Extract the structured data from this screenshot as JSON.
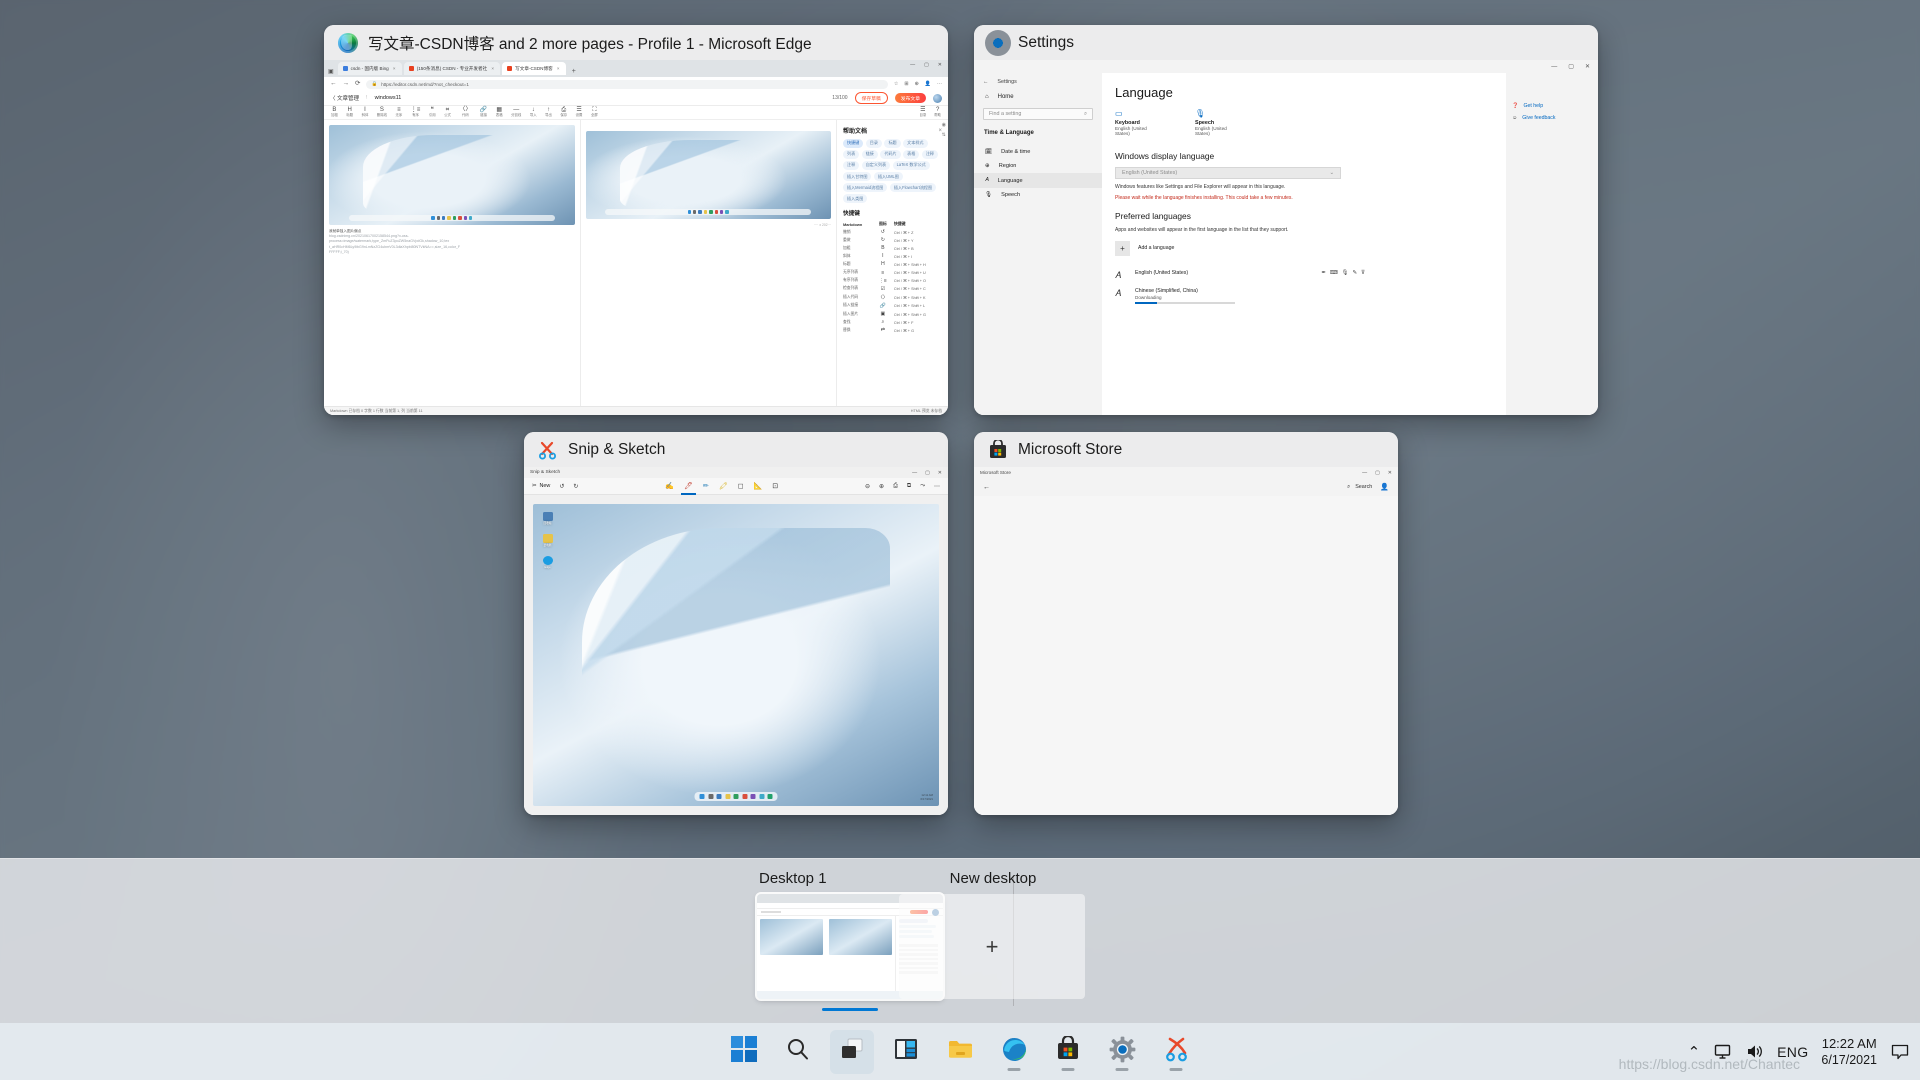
{
  "os": "Windows 11 Task View",
  "windows": {
    "edge": {
      "title": "写文章-CSDN博客 and 2 more pages - Profile 1 - Microsoft Edge",
      "icon": "edge-icon",
      "tabs": [
        {
          "label": "csdn - 国内版 Bing",
          "favicon": "#3b7ddd"
        },
        {
          "label": "(150条消息) CSDN - 专业开发者社",
          "favicon": "#e8401f"
        },
        {
          "label": "写文章-CSDN博客",
          "favicon": "#e8401f",
          "active": true
        }
      ],
      "new_tab_label": "+",
      "url": "https://editor.csdn.net/md/?not_checkout=1",
      "nav": {
        "back": "←",
        "forward": "→",
        "refresh": "⟳",
        "lock": "🔒"
      },
      "toolbar_right": [
        "☆",
        "⊞",
        "⊕",
        "👤",
        "⋯"
      ],
      "csdn": {
        "back_label": "〈 文章管理",
        "title_placeholder": "!",
        "title_value": "windows11",
        "char_count": "13/100",
        "save_draft": "保存草稿",
        "publish": "发布文章",
        "format_tools": [
          {
            "glyph": "B",
            "label": "加粗"
          },
          {
            "glyph": "H",
            "label": "标题"
          },
          {
            "glyph": "I",
            "label": "斜体"
          },
          {
            "glyph": "S",
            "label": "删除线"
          },
          {
            "glyph": "≡",
            "label": "无序"
          },
          {
            "glyph": "⋮≡",
            "label": "有序"
          },
          {
            "glyph": "❝",
            "label": "引用"
          },
          {
            "glyph": "⌗",
            "label": "公式"
          },
          {
            "glyph": "〈〉",
            "label": "代码"
          },
          {
            "glyph": "🔗",
            "label": "链接"
          },
          {
            "glyph": "▦",
            "label": "表格"
          },
          {
            "glyph": "—",
            "label": "分割线"
          },
          {
            "glyph": "↓",
            "label": "导入"
          },
          {
            "glyph": "↑",
            "label": "导出"
          },
          {
            "glyph": "⎙",
            "label": "保存"
          },
          {
            "glyph": "☰",
            "label": "设置"
          },
          {
            "glyph": "⛶",
            "label": "全屏"
          }
        ],
        "right_tools": [
          {
            "glyph": "☰",
            "label": "目录"
          },
          {
            "glyph": "?",
            "label": "帮助"
          }
        ],
        "editor_note_lines": [
          "我就单独入图片偏点",
          "blog.csdnimg.cn/20210617002158544.png?x-oss-",
          "process=image/watermark,type_ZmFuZ3poZW5naGVpdGk,shadow_10,tex",
          "t_aHR0cHM6Ly9ibG9nLmNzZG4ubmV0L3dlaXhpbl80NTVkNA==,size_16,color_F",
          "FFFFF,t_70)"
        ],
        "status_left": "Markdown  已存档  0 字数  1 行数  当前第 1, 列 当前第 11",
        "status_right": "HTML 预览  未存档"
      },
      "help_panel": {
        "title": "帮助文档",
        "close": "×",
        "tags": [
          "快捷键",
          "目录",
          "标题",
          "文本样式",
          "列表",
          "链接",
          "代码片",
          "表格",
          "注释",
          "注释",
          "自定义列表",
          "LaTeX 数学公式",
          "插入甘特图",
          "插入UML图",
          "插入Mermaid流程图",
          "插入Flowchart流程图",
          "插入类图"
        ],
        "shortcut_heading": "快捷键",
        "table_headers": [
          "Markdown",
          "图标",
          "快捷键"
        ],
        "rows": [
          [
            "撤销",
            "↺",
            "Ctrl / ⌘ + Z"
          ],
          [
            "重做",
            "↻",
            "Ctrl / ⌘ + Y"
          ],
          [
            "加粗",
            "B",
            "Ctrl / ⌘ + B"
          ],
          [
            "斜体",
            "I",
            "Ctrl / ⌘ + I"
          ],
          [
            "标题",
            "H",
            "Ctrl / ⌘ + Shift + H"
          ],
          [
            "无序列表",
            "≡",
            "Ctrl / ⌘ + Shift + U"
          ],
          [
            "有序列表",
            "⋮≡",
            "Ctrl / ⌘ + Shift + O"
          ],
          [
            "检查列表",
            "☑",
            "Ctrl / ⌘ + Shift + C"
          ],
          [
            "插入代码",
            "〈〉",
            "Ctrl / ⌘ + Shift + K"
          ],
          [
            "插入链接",
            "🔗",
            "Ctrl / ⌘ + Shift + L"
          ],
          [
            "插入图片",
            "▣",
            "Ctrl / ⌘ + Shift + G"
          ],
          [
            "查找",
            "⌕",
            "Ctrl / ⌘ + F"
          ],
          [
            "替换",
            "⇄",
            "Ctrl / ⌘ + G"
          ]
        ]
      },
      "window_controls": [
        "—",
        "▢",
        "✕"
      ]
    },
    "settings": {
      "title": "Settings",
      "icon": "gear-icon",
      "window_controls": [
        "—",
        "▢",
        "✕"
      ],
      "sidebar": {
        "back_label": "Settings",
        "home": "Home",
        "search_placeholder": "Find a setting",
        "search_icon": "search-icon",
        "group_header": "Time & Language",
        "items": [
          {
            "label": "Date & time",
            "icon": "calendar-clock-icon",
            "selected": false
          },
          {
            "label": "Region",
            "icon": "globe-icon",
            "selected": false
          },
          {
            "label": "Language",
            "icon": "language-icon",
            "selected": true
          },
          {
            "label": "Speech",
            "icon": "microphone-icon",
            "selected": false
          }
        ]
      },
      "content": {
        "heading": "Language",
        "quick_settings": [
          {
            "icon": "keyboard-icon",
            "title": "Keyboard",
            "subtitle": "English (United States)"
          },
          {
            "icon": "speech-icon",
            "title": "Speech",
            "subtitle": "English (United States)"
          }
        ],
        "display_language_heading": "Windows display language",
        "display_language_value": "English (United States)",
        "display_language_note": "Windows features like Settings and File Explorer will appear in this language.",
        "warning": "Please wait while the language finishes installing. This could take a few minutes.",
        "preferred_heading": "Preferred languages",
        "preferred_note": "Apps and websites will appear in the first language in the list that they support.",
        "add_language_label": "Add a language",
        "add_language_icon": "plus-icon",
        "languages": [
          {
            "name": "English (United States)",
            "status": "",
            "icon": "language-badge-icon",
            "actions": [
              "pen-icon",
              "keyboard-icon",
              "microphone-icon",
              "handwriting-icon",
              "text-icon"
            ],
            "progress": null
          },
          {
            "name": "Chinese (Simplified, China)",
            "status": "Downloading",
            "icon": "language-badge-icon",
            "actions": [],
            "progress": 22
          }
        ]
      },
      "right_links": [
        {
          "label": "Get help",
          "icon": "help-icon"
        },
        {
          "label": "Give feedback",
          "icon": "feedback-icon"
        }
      ]
    },
    "snip": {
      "title": "Snip & Sketch",
      "icon": "snip-icon",
      "inner_title": "Snip & Sketch",
      "window_controls": [
        "—",
        "▢",
        "✕"
      ],
      "new_button": "New",
      "toolbar_left_icons": [
        "new-icon",
        "undo-icon",
        "redo-icon"
      ],
      "toolbar_center_icons": [
        "touch-writing-icon",
        "ballpoint-pen-icon",
        "pencil-icon",
        "highlighter-icon",
        "eraser-icon",
        "ruler-icon",
        "crop-icon"
      ],
      "toolbar_right_icons": [
        "zoom-out-icon",
        "zoom-in-icon",
        "save-icon",
        "copy-icon",
        "share-icon",
        "more-icon"
      ],
      "desktop_icons": [
        {
          "label": "回收站",
          "color": "#3d6fa8"
        },
        {
          "label": "此电脑",
          "color": "#e6c34a"
        },
        {
          "label": "Edge",
          "color": "#1b9de2"
        }
      ],
      "clock_line1": "12:11 AM",
      "clock_line2": "6/17/2021"
    },
    "store": {
      "title": "Microsoft Store",
      "icon": "store-icon",
      "inner_title": "Microsoft Store",
      "window_controls": [
        "—",
        "▢",
        "✕"
      ],
      "back_icon": "back-arrow-icon",
      "search_label": "Search",
      "search_icon": "search-icon",
      "account_icon": "account-icon"
    }
  },
  "desktops": {
    "items": [
      {
        "label": "Desktop 1",
        "active": true
      },
      {
        "label": "New desktop",
        "active": false,
        "add_icon": "plus-icon"
      }
    ]
  },
  "taskbar": {
    "items": [
      {
        "name": "start-button",
        "icon": "windows-logo-icon",
        "active": false,
        "running": false
      },
      {
        "name": "search-button",
        "icon": "search-icon",
        "active": false,
        "running": false
      },
      {
        "name": "task-view-button",
        "icon": "task-view-icon",
        "active": true,
        "running": false
      },
      {
        "name": "widgets-button",
        "icon": "widgets-icon",
        "active": false,
        "running": false
      },
      {
        "name": "file-explorer-button",
        "icon": "folder-icon",
        "active": false,
        "running": false
      },
      {
        "name": "edge-button",
        "icon": "edge-icon",
        "active": false,
        "running": true
      },
      {
        "name": "store-button",
        "icon": "store-icon",
        "active": false,
        "running": true
      },
      {
        "name": "settings-button",
        "icon": "gear-icon",
        "active": false,
        "running": true
      },
      {
        "name": "snip-button",
        "icon": "snip-icon",
        "active": false,
        "running": true
      }
    ],
    "tray": {
      "chevron": "⌃",
      "network_icon": "network-icon",
      "volume_icon": "volume-icon",
      "language": "ENG",
      "time": "12:22 AM",
      "date": "6/17/2021",
      "notification_icon": "chat-icon"
    },
    "watermark": "https://blog.csdn.net/Chantec"
  },
  "colors": {
    "accent": "#0067c0",
    "warning": "#c42b1c",
    "taskbar_bg": "#eef3f7",
    "window_bg": "#ececed"
  }
}
